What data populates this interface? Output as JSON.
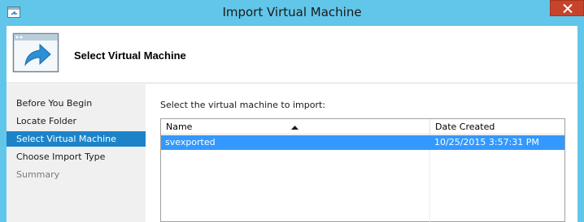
{
  "window": {
    "title": "Import Virtual Machine"
  },
  "header": {
    "title": "Select Virtual Machine"
  },
  "nav": {
    "items": [
      {
        "label": "Before You Begin",
        "state": "normal"
      },
      {
        "label": "Locate Folder",
        "state": "normal"
      },
      {
        "label": "Select Virtual Machine",
        "state": "selected"
      },
      {
        "label": "Choose Import Type",
        "state": "normal"
      },
      {
        "label": "Summary",
        "state": "disabled"
      }
    ]
  },
  "main": {
    "prompt": "Select the virtual machine to import:",
    "list": {
      "columns": [
        "Name",
        "Date Created"
      ],
      "sort_column": "Name",
      "sort_direction": "ascending",
      "rows": [
        {
          "name": "svexported",
          "date_created": "10/25/2015 3:57:31 PM",
          "selected": true
        }
      ]
    }
  },
  "colors": {
    "titlebar": "#62c6ea",
    "close_button": "#c7432c",
    "nav_selected": "#1c83c9",
    "row_selected": "#3399ff"
  },
  "icons": {
    "window": "window-icon",
    "header": "import-arrow-icon",
    "close": "close-icon",
    "sort": "sort-ascending-icon"
  }
}
